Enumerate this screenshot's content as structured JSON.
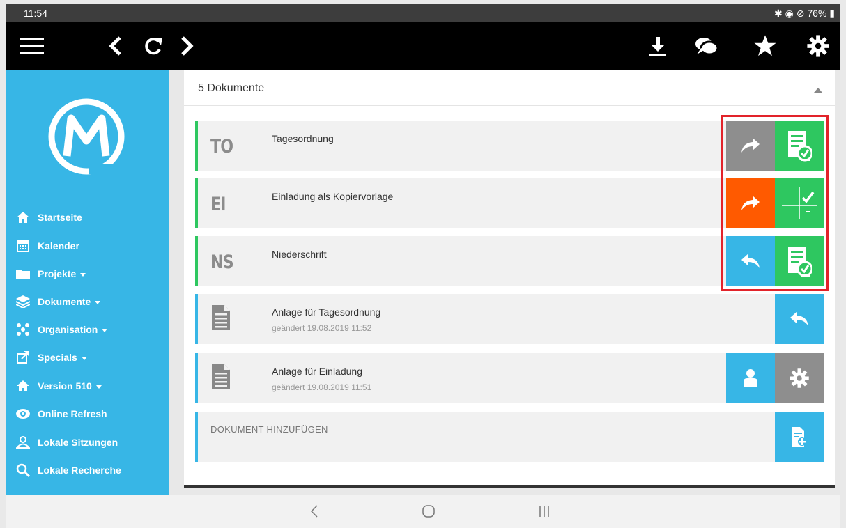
{
  "status": {
    "time": "11:54",
    "icons": "✱ ◉ ⊘ 76% ▮"
  },
  "toolbar": {
    "icons": [
      "menu-icon",
      "back-icon",
      "reload-icon",
      "forward-icon",
      "download-icon",
      "chat-icon",
      "star-icon",
      "gear-icon"
    ]
  },
  "sidebar": {
    "items": [
      {
        "label": "Startseite",
        "icon": "home-icon"
      },
      {
        "label": "Kalender",
        "icon": "calendar-icon"
      },
      {
        "label": "Projekte",
        "icon": "folder-icon"
      },
      {
        "label": "Dokumente",
        "icon": "layers-icon"
      },
      {
        "label": "Organisation",
        "icon": "org-icon"
      },
      {
        "label": "Specials",
        "icon": "external-link-icon"
      },
      {
        "label": "Version 510",
        "icon": "home-icon"
      },
      {
        "label": "Online Refresh",
        "icon": "eye-icon"
      },
      {
        "label": "Lokale Sitzungen",
        "icon": "user-icon"
      },
      {
        "label": "Lokale Recherche",
        "icon": "search-icon"
      }
    ]
  },
  "panel": {
    "title": "5 Dokumente",
    "rows": [
      {
        "abbr": "TO",
        "title": "Tagesordnung",
        "subtitle": ""
      },
      {
        "abbr": "EI",
        "title": "Einladung als Kopiervorlage",
        "subtitle": ""
      },
      {
        "abbr": "NS",
        "title": "Niederschrift",
        "subtitle": ""
      },
      {
        "abbr": "",
        "title": "Anlage für Tagesordnung",
        "subtitle": "geändert 19.08.2019 11:52"
      },
      {
        "abbr": "",
        "title": "Anlage für Einladung",
        "subtitle": "geändert 19.08.2019 11:51"
      }
    ],
    "add_label": "DOKUMENT HINZUFÜGEN"
  },
  "colors": {
    "accent": "#37b6e6",
    "green": "#2ec760",
    "orange": "#ff5a00",
    "gray": "#8e8e8e",
    "highlight": "#e2232a"
  }
}
